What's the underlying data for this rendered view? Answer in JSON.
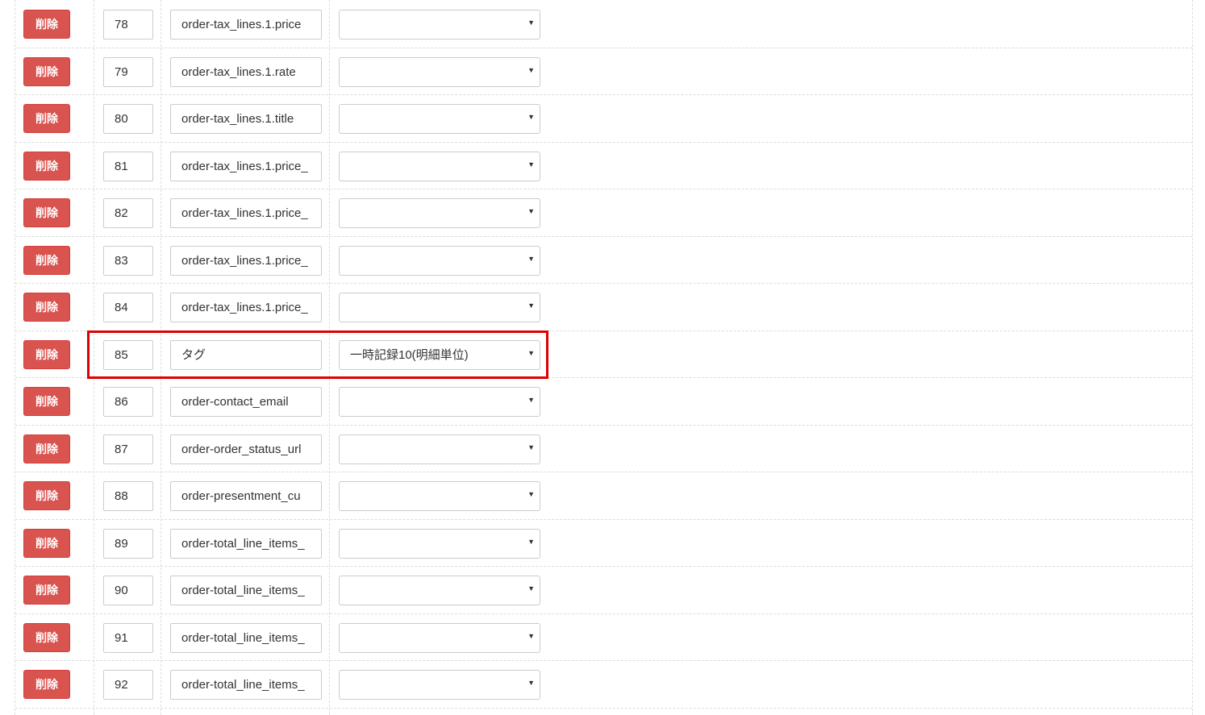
{
  "delete_label": "削除",
  "highlight_color": "#e00000",
  "rows": [
    {
      "num": "78",
      "field": "order-tax_lines.1.price",
      "select": ""
    },
    {
      "num": "79",
      "field": "order-tax_lines.1.rate",
      "select": ""
    },
    {
      "num": "80",
      "field": "order-tax_lines.1.title",
      "select": ""
    },
    {
      "num": "81",
      "field": "order-tax_lines.1.price_",
      "select": ""
    },
    {
      "num": "82",
      "field": "order-tax_lines.1.price_",
      "select": ""
    },
    {
      "num": "83",
      "field": "order-tax_lines.1.price_",
      "select": ""
    },
    {
      "num": "84",
      "field": "order-tax_lines.1.price_",
      "select": ""
    },
    {
      "num": "85",
      "field": "タグ",
      "select": "一時記録10(明細単位)"
    },
    {
      "num": "86",
      "field": "order-contact_email",
      "select": ""
    },
    {
      "num": "87",
      "field": "order-order_status_url",
      "select": ""
    },
    {
      "num": "88",
      "field": "order-presentment_cu",
      "select": ""
    },
    {
      "num": "89",
      "field": "order-total_line_items_",
      "select": ""
    },
    {
      "num": "90",
      "field": "order-total_line_items_",
      "select": ""
    },
    {
      "num": "91",
      "field": "order-total_line_items_",
      "select": ""
    },
    {
      "num": "92",
      "field": "order-total_line_items_",
      "select": ""
    }
  ]
}
